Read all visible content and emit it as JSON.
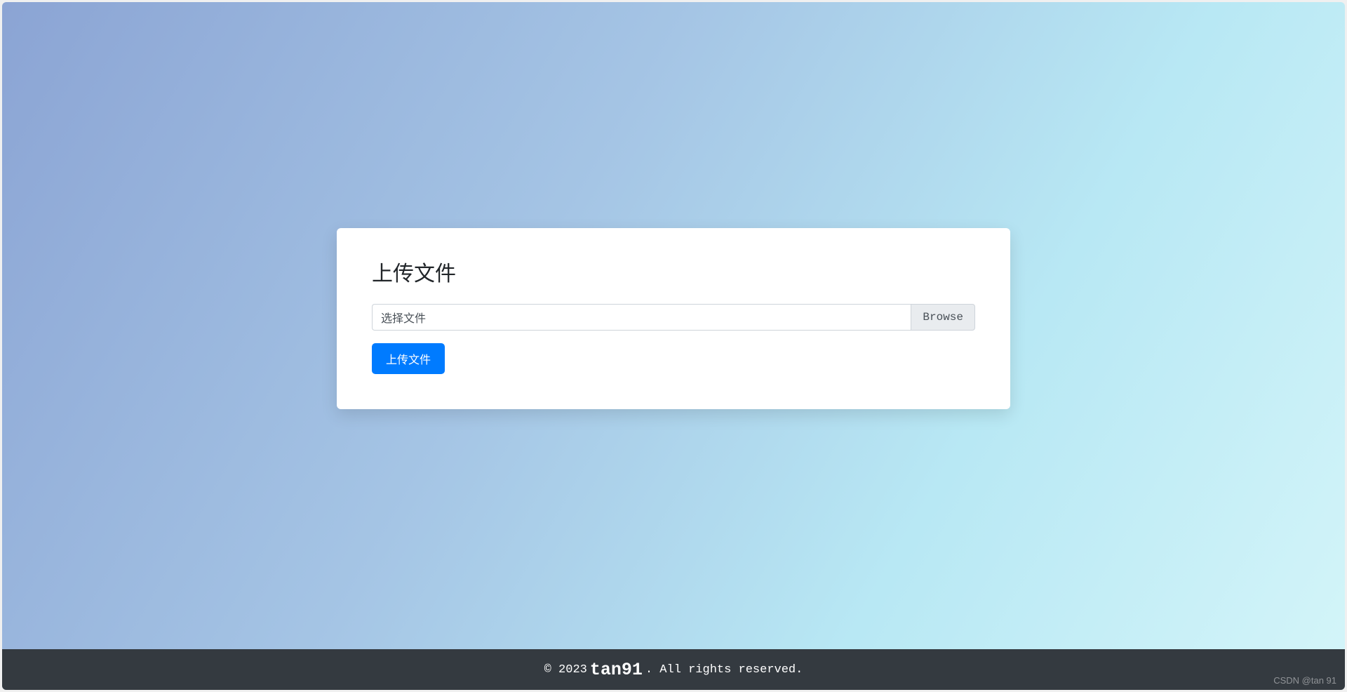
{
  "card": {
    "title": "上传文件",
    "file_input_placeholder": "选择文件",
    "browse_label": "Browse",
    "upload_button_label": "上传文件"
  },
  "footer": {
    "copyright_prefix": "© 2023",
    "brand": "tan91",
    "copyright_suffix": ". All rights reserved."
  },
  "watermark": "CSDN @tan 91"
}
